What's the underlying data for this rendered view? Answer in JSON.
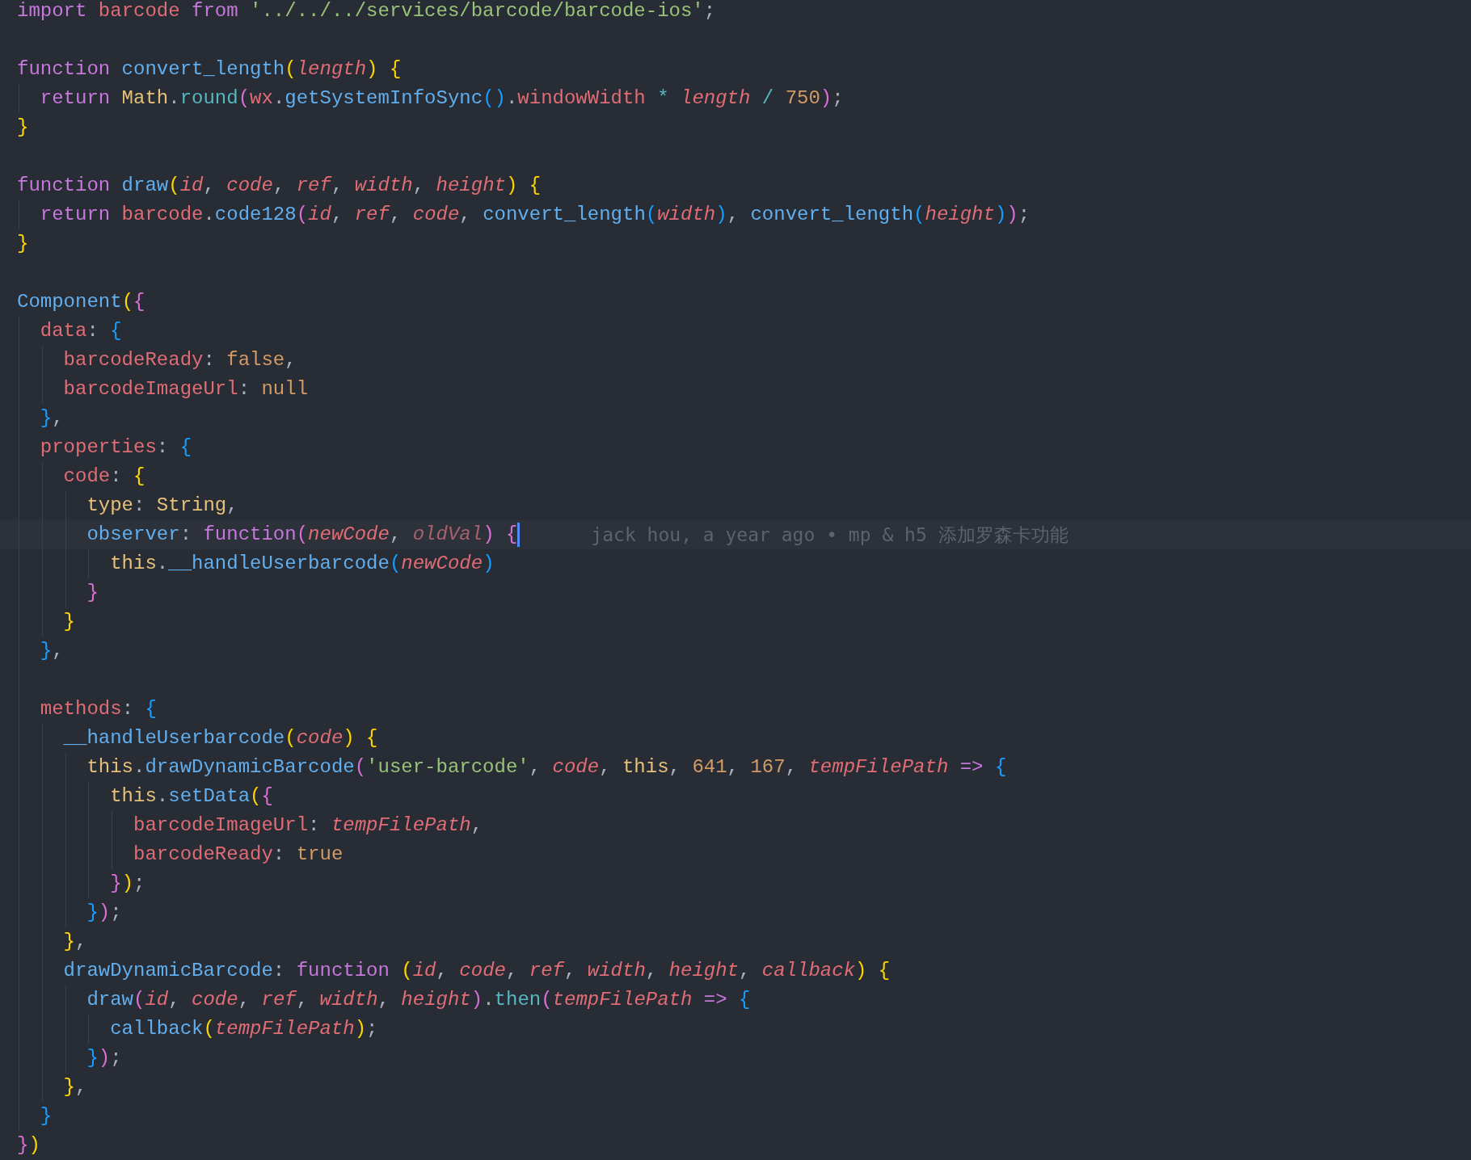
{
  "editor": {
    "lines": [
      {
        "current": false,
        "tokens": [
          {
            "kind": "kw",
            "text": "import"
          },
          {
            "kind": "var",
            "text": " barcode"
          },
          {
            "kind": "kw",
            "text": " from"
          },
          {
            "kind": "str",
            "text": " '../../../services/barcode/barcode-ios'"
          },
          {
            "kind": "txt",
            "text": ";"
          }
        ]
      },
      {
        "current": false
      },
      {
        "current": false,
        "tokens": [
          {
            "kind": "kw",
            "text": "function"
          },
          {
            "kind": "fn",
            "text": " convert_length"
          },
          {
            "kind": "br1",
            "text": "("
          },
          {
            "kind": "par",
            "text": "length"
          },
          {
            "kind": "br1",
            "text": ")"
          },
          {
            "kind": "br1",
            "text": " {"
          }
        ]
      },
      {
        "current": false,
        "tokens": [
          {
            "kind": "kw",
            "text": "  return"
          },
          {
            "kind": "cls",
            "text": " Math"
          },
          {
            "kind": "txt",
            "text": "."
          },
          {
            "kind": "op",
            "text": "round"
          },
          {
            "kind": "br2",
            "text": "("
          },
          {
            "kind": "var",
            "text": "wx"
          },
          {
            "kind": "txt",
            "text": "."
          },
          {
            "kind": "fn",
            "text": "getSystemInfoSync"
          },
          {
            "kind": "br3",
            "text": "()"
          },
          {
            "kind": "txt",
            "text": "."
          },
          {
            "kind": "var",
            "text": "windowWidth"
          },
          {
            "kind": "op",
            "text": " *"
          },
          {
            "kind": "par",
            "text": " length"
          },
          {
            "kind": "op",
            "text": " /"
          },
          {
            "kind": "num",
            "text": " 750"
          },
          {
            "kind": "br2",
            "text": ")"
          },
          {
            "kind": "txt",
            "text": ";"
          }
        ]
      },
      {
        "current": false,
        "tokens": [
          {
            "kind": "br1",
            "text": "}"
          }
        ]
      },
      {
        "current": false
      },
      {
        "current": false,
        "tokens": [
          {
            "kind": "kw",
            "text": "function"
          },
          {
            "kind": "fn",
            "text": " draw"
          },
          {
            "kind": "br1",
            "text": "("
          },
          {
            "kind": "par",
            "text": "id"
          },
          {
            "kind": "txt",
            "text": ", "
          },
          {
            "kind": "par",
            "text": "code"
          },
          {
            "kind": "txt",
            "text": ", "
          },
          {
            "kind": "par",
            "text": "ref"
          },
          {
            "kind": "txt",
            "text": ", "
          },
          {
            "kind": "par",
            "text": "width"
          },
          {
            "kind": "txt",
            "text": ", "
          },
          {
            "kind": "par",
            "text": "height"
          },
          {
            "kind": "br1",
            "text": ")"
          },
          {
            "kind": "br1",
            "text": " {"
          }
        ]
      },
      {
        "current": false,
        "tokens": [
          {
            "kind": "kw",
            "text": "  return"
          },
          {
            "kind": "var",
            "text": " barcode"
          },
          {
            "kind": "txt",
            "text": "."
          },
          {
            "kind": "fn",
            "text": "code128"
          },
          {
            "kind": "br2",
            "text": "("
          },
          {
            "kind": "par",
            "text": "id"
          },
          {
            "kind": "txt",
            "text": ", "
          },
          {
            "kind": "par",
            "text": "ref"
          },
          {
            "kind": "txt",
            "text": ", "
          },
          {
            "kind": "par",
            "text": "code"
          },
          {
            "kind": "txt",
            "text": ", "
          },
          {
            "kind": "fn",
            "text": "convert_length"
          },
          {
            "kind": "br3",
            "text": "("
          },
          {
            "kind": "par",
            "text": "width"
          },
          {
            "kind": "br3",
            "text": ")"
          },
          {
            "kind": "txt",
            "text": ", "
          },
          {
            "kind": "fn",
            "text": "convert_length"
          },
          {
            "kind": "br3",
            "text": "("
          },
          {
            "kind": "par",
            "text": "height"
          },
          {
            "kind": "br3",
            "text": ")"
          },
          {
            "kind": "br2",
            "text": ")"
          },
          {
            "kind": "txt",
            "text": ";"
          }
        ]
      },
      {
        "current": false,
        "tokens": [
          {
            "kind": "br1",
            "text": "}"
          }
        ]
      },
      {
        "current": false
      },
      {
        "current": false,
        "tokens": [
          {
            "kind": "fn",
            "text": "Component"
          },
          {
            "kind": "br1",
            "text": "("
          },
          {
            "kind": "br2",
            "text": "{"
          }
        ]
      },
      {
        "current": false,
        "tokens": [
          {
            "kind": "var",
            "text": "  data"
          },
          {
            "kind": "txt",
            "text": ": "
          },
          {
            "kind": "br3",
            "text": "{"
          }
        ]
      },
      {
        "current": false,
        "tokens": [
          {
            "kind": "var",
            "text": "    barcodeReady"
          },
          {
            "kind": "txt",
            "text": ": "
          },
          {
            "kind": "num",
            "text": "false"
          },
          {
            "kind": "txt",
            "text": ","
          }
        ]
      },
      {
        "current": false,
        "tokens": [
          {
            "kind": "var",
            "text": "    barcodeImageUrl"
          },
          {
            "kind": "txt",
            "text": ": "
          },
          {
            "kind": "num",
            "text": "null"
          }
        ]
      },
      {
        "current": false,
        "tokens": [
          {
            "kind": "br3",
            "text": "  }"
          },
          {
            "kind": "txt",
            "text": ","
          }
        ]
      },
      {
        "current": false,
        "tokens": [
          {
            "kind": "var",
            "text": "  properties"
          },
          {
            "kind": "txt",
            "text": ": "
          },
          {
            "kind": "br3",
            "text": "{"
          }
        ]
      },
      {
        "current": false,
        "tokens": [
          {
            "kind": "var",
            "text": "    code"
          },
          {
            "kind": "txt",
            "text": ": "
          },
          {
            "kind": "br1",
            "text": "{"
          }
        ]
      },
      {
        "current": false,
        "tokens": [
          {
            "kind": "cls",
            "text": "      type"
          },
          {
            "kind": "txt",
            "text": ": "
          },
          {
            "kind": "cls",
            "text": "String"
          },
          {
            "kind": "txt",
            "text": ","
          }
        ]
      },
      {
        "current": true,
        "blame": "jack hou, a year ago • mp & h5 添加罗森卡功能",
        "tokens": [
          {
            "kind": "fn",
            "text": "      observer"
          },
          {
            "kind": "txt",
            "text": ": "
          },
          {
            "kind": "kw",
            "text": "function"
          },
          {
            "kind": "br2",
            "text": "("
          },
          {
            "kind": "par",
            "text": "newCode"
          },
          {
            "kind": "txt",
            "text": ", "
          },
          {
            "kind": "unused",
            "text": "oldVal"
          },
          {
            "kind": "br2",
            "text": ")"
          },
          {
            "kind": "br2",
            "text": " {"
          }
        ]
      },
      {
        "current": false,
        "tokens": [
          {
            "kind": "this",
            "text": "        this"
          },
          {
            "kind": "txt",
            "text": "."
          },
          {
            "kind": "fn",
            "text": "__handleUserbarcode"
          },
          {
            "kind": "br3",
            "text": "("
          },
          {
            "kind": "par",
            "text": "newCode"
          },
          {
            "kind": "br3",
            "text": ")"
          }
        ]
      },
      {
        "current": false,
        "tokens": [
          {
            "kind": "br2",
            "text": "      }"
          }
        ]
      },
      {
        "current": false,
        "tokens": [
          {
            "kind": "br1",
            "text": "    }"
          }
        ]
      },
      {
        "current": false,
        "tokens": [
          {
            "kind": "br3",
            "text": "  }"
          },
          {
            "kind": "txt",
            "text": ","
          }
        ]
      },
      {
        "current": false
      },
      {
        "current": false,
        "tokens": [
          {
            "kind": "var",
            "text": "  methods"
          },
          {
            "kind": "txt",
            "text": ": "
          },
          {
            "kind": "br3",
            "text": "{"
          }
        ]
      },
      {
        "current": false,
        "tokens": [
          {
            "kind": "fn",
            "text": "    __handleUserbarcode"
          },
          {
            "kind": "br1",
            "text": "("
          },
          {
            "kind": "par",
            "text": "code"
          },
          {
            "kind": "br1",
            "text": ")"
          },
          {
            "kind": "br1",
            "text": " {"
          }
        ]
      },
      {
        "current": false,
        "tokens": [
          {
            "kind": "this",
            "text": "      this"
          },
          {
            "kind": "txt",
            "text": "."
          },
          {
            "kind": "fn",
            "text": "drawDynamicBarcode"
          },
          {
            "kind": "br2",
            "text": "("
          },
          {
            "kind": "str",
            "text": "'user-barcode'"
          },
          {
            "kind": "txt",
            "text": ", "
          },
          {
            "kind": "par",
            "text": "code"
          },
          {
            "kind": "txt",
            "text": ", "
          },
          {
            "kind": "this",
            "text": "this"
          },
          {
            "kind": "txt",
            "text": ", "
          },
          {
            "kind": "num",
            "text": "641"
          },
          {
            "kind": "txt",
            "text": ", "
          },
          {
            "kind": "num",
            "text": "167"
          },
          {
            "kind": "txt",
            "text": ", "
          },
          {
            "kind": "par",
            "text": "tempFilePath"
          },
          {
            "kind": "kw",
            "text": " =>"
          },
          {
            "kind": "br3",
            "text": " {"
          }
        ]
      },
      {
        "current": false,
        "tokens": [
          {
            "kind": "this",
            "text": "        this"
          },
          {
            "kind": "txt",
            "text": "."
          },
          {
            "kind": "fn",
            "text": "setData"
          },
          {
            "kind": "br1",
            "text": "("
          },
          {
            "kind": "br2",
            "text": "{"
          }
        ]
      },
      {
        "current": false,
        "tokens": [
          {
            "kind": "var",
            "text": "          barcodeImageUrl"
          },
          {
            "kind": "txt",
            "text": ": "
          },
          {
            "kind": "par",
            "text": "tempFilePath"
          },
          {
            "kind": "txt",
            "text": ","
          }
        ]
      },
      {
        "current": false,
        "tokens": [
          {
            "kind": "var",
            "text": "          barcodeReady"
          },
          {
            "kind": "txt",
            "text": ": "
          },
          {
            "kind": "num",
            "text": "true"
          }
        ]
      },
      {
        "current": false,
        "tokens": [
          {
            "kind": "br2",
            "text": "        }"
          },
          {
            "kind": "br1",
            "text": ")"
          },
          {
            "kind": "txt",
            "text": ";"
          }
        ]
      },
      {
        "current": false,
        "tokens": [
          {
            "kind": "br3",
            "text": "      }"
          },
          {
            "kind": "br2",
            "text": ")"
          },
          {
            "kind": "txt",
            "text": ";"
          }
        ]
      },
      {
        "current": false,
        "tokens": [
          {
            "kind": "br1",
            "text": "    }"
          },
          {
            "kind": "txt",
            "text": ","
          }
        ]
      },
      {
        "current": false,
        "tokens": [
          {
            "kind": "fn",
            "text": "    drawDynamicBarcode"
          },
          {
            "kind": "txt",
            "text": ": "
          },
          {
            "kind": "kw",
            "text": "function"
          },
          {
            "kind": "br1",
            "text": " ("
          },
          {
            "kind": "par",
            "text": "id"
          },
          {
            "kind": "txt",
            "text": ", "
          },
          {
            "kind": "par",
            "text": "code"
          },
          {
            "kind": "txt",
            "text": ", "
          },
          {
            "kind": "par",
            "text": "ref"
          },
          {
            "kind": "txt",
            "text": ", "
          },
          {
            "kind": "par",
            "text": "width"
          },
          {
            "kind": "txt",
            "text": ", "
          },
          {
            "kind": "par",
            "text": "height"
          },
          {
            "kind": "txt",
            "text": ", "
          },
          {
            "kind": "par",
            "text": "callback"
          },
          {
            "kind": "br1",
            "text": ")"
          },
          {
            "kind": "br1",
            "text": " {"
          }
        ]
      },
      {
        "current": false,
        "tokens": [
          {
            "kind": "fn",
            "text": "      draw"
          },
          {
            "kind": "br2",
            "text": "("
          },
          {
            "kind": "par",
            "text": "id"
          },
          {
            "kind": "txt",
            "text": ", "
          },
          {
            "kind": "par",
            "text": "code"
          },
          {
            "kind": "txt",
            "text": ", "
          },
          {
            "kind": "par",
            "text": "ref"
          },
          {
            "kind": "txt",
            "text": ", "
          },
          {
            "kind": "par",
            "text": "width"
          },
          {
            "kind": "txt",
            "text": ", "
          },
          {
            "kind": "par",
            "text": "height"
          },
          {
            "kind": "br2",
            "text": ")"
          },
          {
            "kind": "txt",
            "text": "."
          },
          {
            "kind": "op",
            "text": "then"
          },
          {
            "kind": "br2",
            "text": "("
          },
          {
            "kind": "par",
            "text": "tempFilePath"
          },
          {
            "kind": "kw",
            "text": " =>"
          },
          {
            "kind": "br3",
            "text": " {"
          }
        ]
      },
      {
        "current": false,
        "tokens": [
          {
            "kind": "fn",
            "text": "        callback"
          },
          {
            "kind": "br1",
            "text": "("
          },
          {
            "kind": "par",
            "text": "tempFilePath"
          },
          {
            "kind": "br1",
            "text": ")"
          },
          {
            "kind": "txt",
            "text": ";"
          }
        ]
      },
      {
        "current": false,
        "tokens": [
          {
            "kind": "br3",
            "text": "      }"
          },
          {
            "kind": "br2",
            "text": ")"
          },
          {
            "kind": "txt",
            "text": ";"
          }
        ]
      },
      {
        "current": false,
        "tokens": [
          {
            "kind": "br1",
            "text": "    }"
          },
          {
            "kind": "txt",
            "text": ","
          }
        ]
      },
      {
        "current": false,
        "tokens": [
          {
            "kind": "br3",
            "text": "  }"
          }
        ]
      },
      {
        "current": false,
        "tokens": [
          {
            "kind": "br2",
            "text": "}"
          },
          {
            "kind": "br1",
            "text": ")"
          }
        ]
      }
    ]
  }
}
